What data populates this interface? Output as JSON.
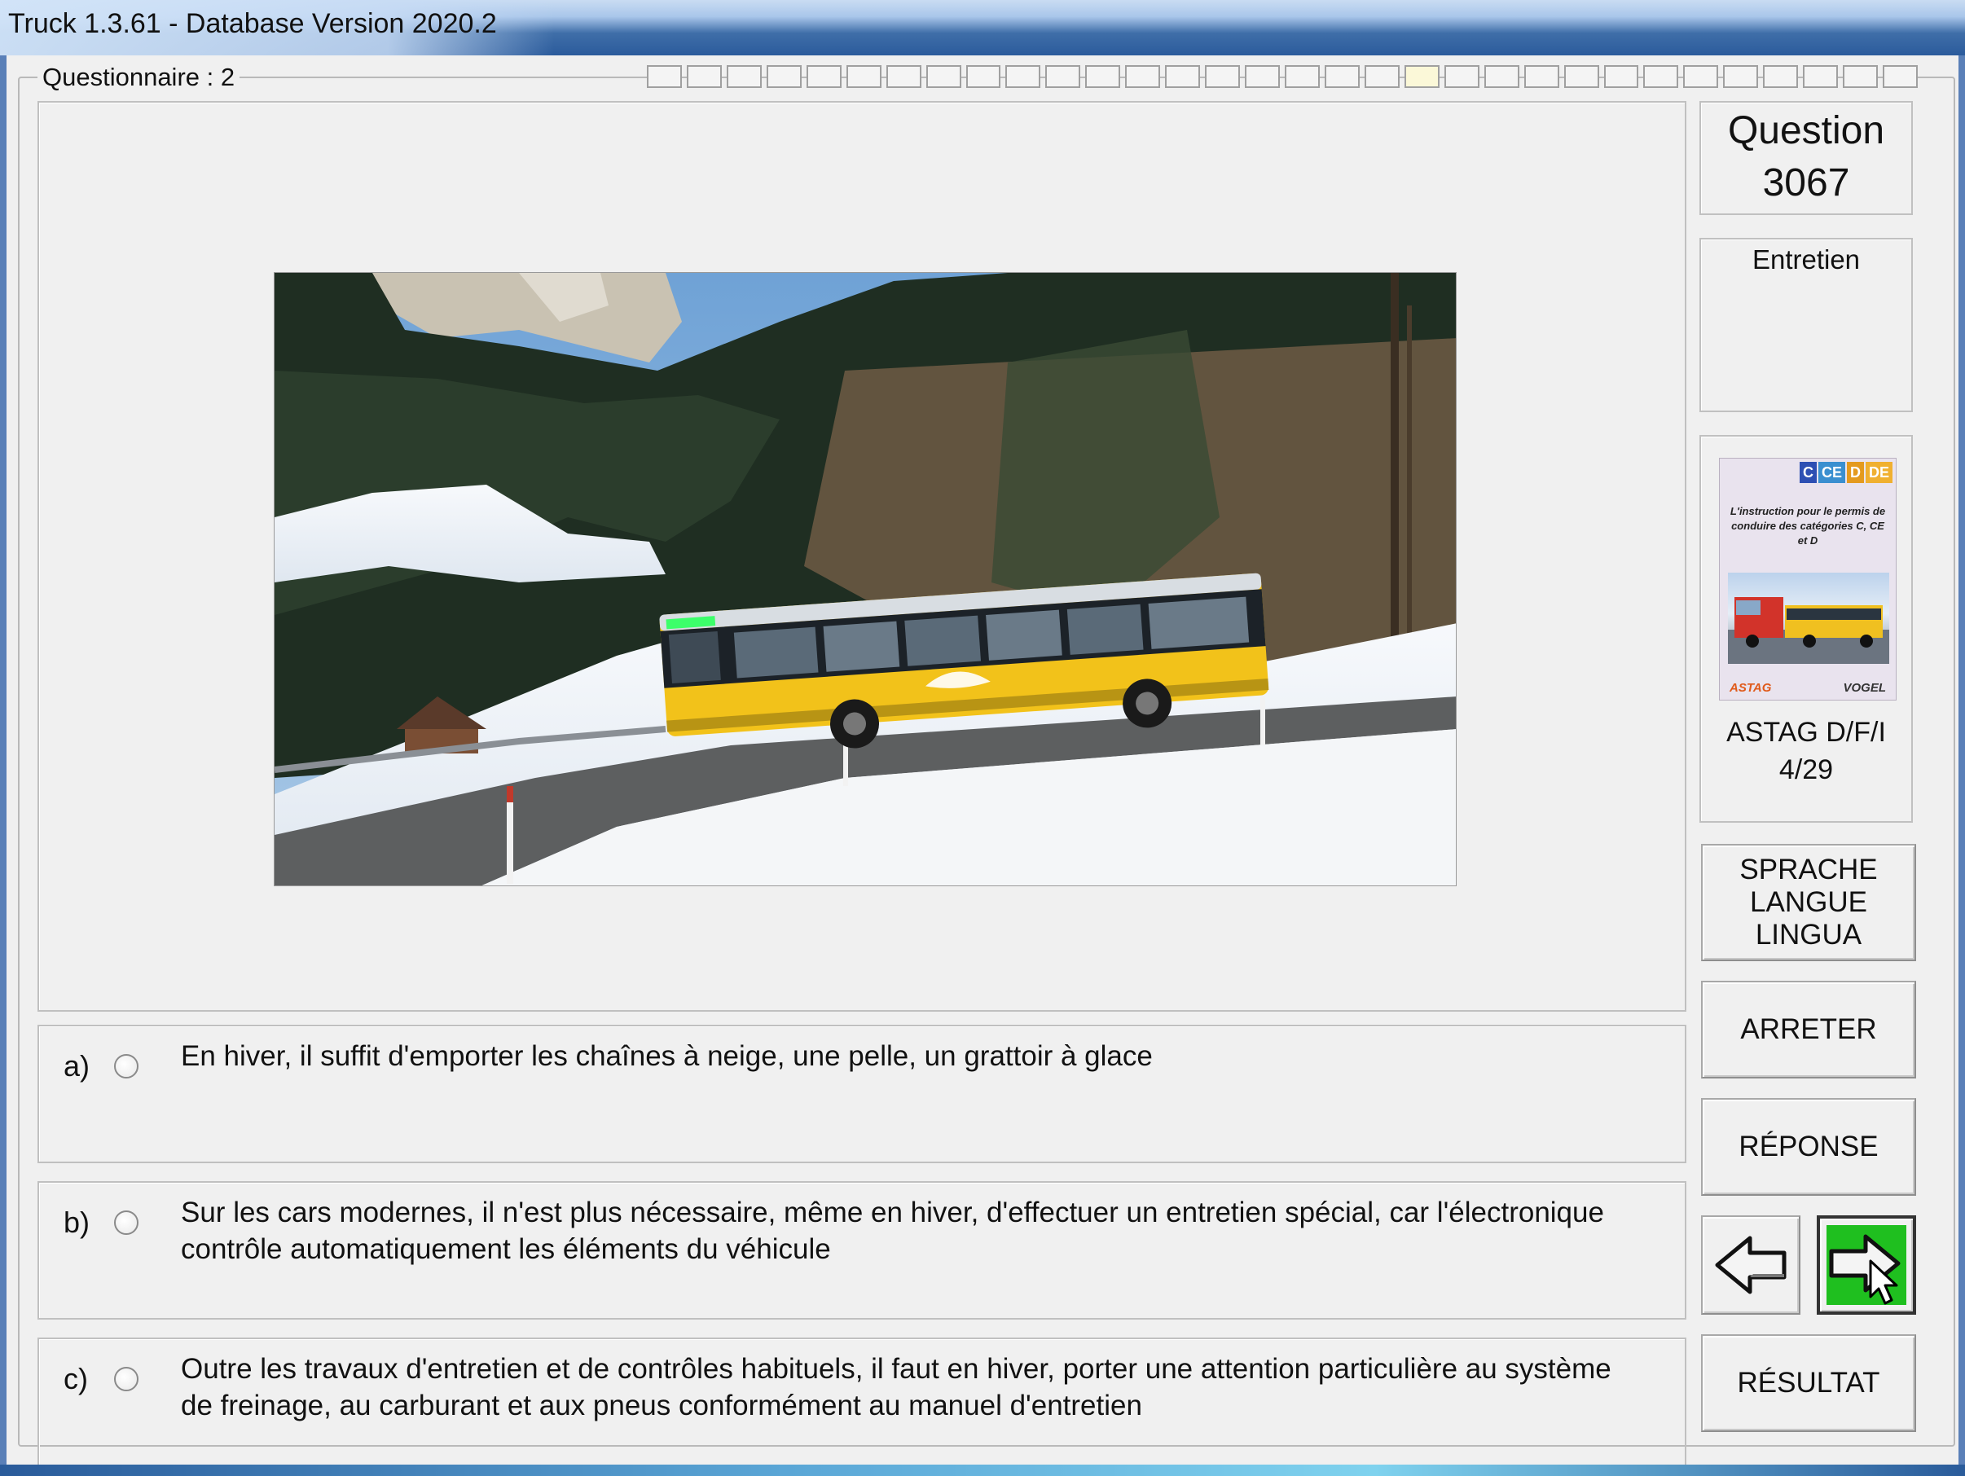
{
  "window": {
    "title": "Truck 1.3.61 - Database Version 2020.2"
  },
  "questionnaire": {
    "label": "Questionnaire : 2",
    "progress_cells": 32,
    "current_cell": 19
  },
  "question": {
    "title": "Question",
    "number": "3067",
    "category": "Entretien",
    "image": "postbus-winter-road-photo"
  },
  "reference": {
    "badges": [
      "C",
      "CE",
      "D",
      "DE"
    ],
    "book_text": "L'instruction pour le permis de conduire des catégories C, CE et D",
    "publishers": [
      "ASTAG",
      "VOGEL"
    ],
    "source": "ASTAG D/F/I",
    "page": "4/29"
  },
  "answers": [
    {
      "letter": "a)",
      "text": "En hiver, il suffit d'emporter les chaînes à neige, une pelle, un grattoir à glace"
    },
    {
      "letter": "b)",
      "text": "Sur les cars modernes, il n'est plus nécessaire, même en hiver, d'effectuer un entretien spécial, car l'électronique contrôle automatiquement les éléments du véhicule"
    },
    {
      "letter": "c)",
      "text": "Outre les travaux d'entretien et de contrôles habituels, il faut en hiver, porter une attention particulière au système de freinage, au carburant et aux pneus conformément au manuel d'entretien"
    }
  ],
  "buttons": {
    "language_lines": [
      "SPRACHE",
      "LANGUE",
      "LINGUA"
    ],
    "stop": "ARRETER",
    "response": "RÉPONSE",
    "result": "RÉSULTAT",
    "prev_icon": "arrow-left-icon",
    "next_icon": "arrow-right-icon"
  },
  "colors": {
    "next_button": "#1fbf1f",
    "bus_yellow": "#f2c21a"
  }
}
